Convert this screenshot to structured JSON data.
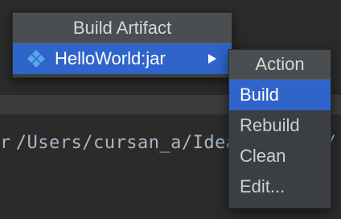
{
  "background": {
    "console_prefix": "r",
    "console_path": "/Users/cursan_a/IdeaProjects/"
  },
  "popup": {
    "title": "Build Artifact",
    "artifact": {
      "label": "HelloWorld:jar",
      "icon": "artifact-diamond-icon"
    }
  },
  "submenu": {
    "title": "Action",
    "items": [
      {
        "label": "Build",
        "selected": true
      },
      {
        "label": "Rebuild",
        "selected": false
      },
      {
        "label": "Clean",
        "selected": false
      },
      {
        "label": "Edit...",
        "selected": false
      }
    ]
  },
  "colors": {
    "selection": "#2f65ca",
    "popup_bg": "#3c3f41",
    "header_bg": "#4b4e50",
    "editor_bg": "#2b2b2b",
    "icon_blue": "#59a7e8"
  }
}
